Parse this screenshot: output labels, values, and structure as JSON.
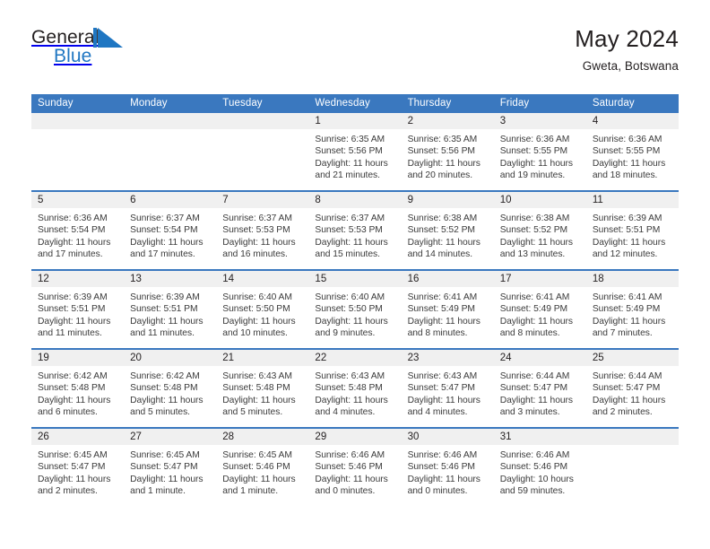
{
  "brand": {
    "name_part1": "General",
    "name_part2": "Blue",
    "triangle_color": "#1f76c2",
    "text_color": "#231f20"
  },
  "header": {
    "title": "May 2024",
    "subtitle": "Gweta, Botswana"
  },
  "theme": {
    "header_bar_color": "#3a78bf",
    "daynum_band_color": "#f0f0f0",
    "separator_color": "#3a78bf",
    "body_text_color": "#3b3b3b"
  },
  "weekday_headers": [
    "Sunday",
    "Monday",
    "Tuesday",
    "Wednesday",
    "Thursday",
    "Friday",
    "Saturday"
  ],
  "weeks": [
    [
      {
        "day": "",
        "lines": []
      },
      {
        "day": "",
        "lines": []
      },
      {
        "day": "",
        "lines": []
      },
      {
        "day": "1",
        "lines": [
          "Sunrise: 6:35 AM",
          "Sunset: 5:56 PM",
          "Daylight: 11 hours",
          "and 21 minutes."
        ]
      },
      {
        "day": "2",
        "lines": [
          "Sunrise: 6:35 AM",
          "Sunset: 5:56 PM",
          "Daylight: 11 hours",
          "and 20 minutes."
        ]
      },
      {
        "day": "3",
        "lines": [
          "Sunrise: 6:36 AM",
          "Sunset: 5:55 PM",
          "Daylight: 11 hours",
          "and 19 minutes."
        ]
      },
      {
        "day": "4",
        "lines": [
          "Sunrise: 6:36 AM",
          "Sunset: 5:55 PM",
          "Daylight: 11 hours",
          "and 18 minutes."
        ]
      }
    ],
    [
      {
        "day": "5",
        "lines": [
          "Sunrise: 6:36 AM",
          "Sunset: 5:54 PM",
          "Daylight: 11 hours",
          "and 17 minutes."
        ]
      },
      {
        "day": "6",
        "lines": [
          "Sunrise: 6:37 AM",
          "Sunset: 5:54 PM",
          "Daylight: 11 hours",
          "and 17 minutes."
        ]
      },
      {
        "day": "7",
        "lines": [
          "Sunrise: 6:37 AM",
          "Sunset: 5:53 PM",
          "Daylight: 11 hours",
          "and 16 minutes."
        ]
      },
      {
        "day": "8",
        "lines": [
          "Sunrise: 6:37 AM",
          "Sunset: 5:53 PM",
          "Daylight: 11 hours",
          "and 15 minutes."
        ]
      },
      {
        "day": "9",
        "lines": [
          "Sunrise: 6:38 AM",
          "Sunset: 5:52 PM",
          "Daylight: 11 hours",
          "and 14 minutes."
        ]
      },
      {
        "day": "10",
        "lines": [
          "Sunrise: 6:38 AM",
          "Sunset: 5:52 PM",
          "Daylight: 11 hours",
          "and 13 minutes."
        ]
      },
      {
        "day": "11",
        "lines": [
          "Sunrise: 6:39 AM",
          "Sunset: 5:51 PM",
          "Daylight: 11 hours",
          "and 12 minutes."
        ]
      }
    ],
    [
      {
        "day": "12",
        "lines": [
          "Sunrise: 6:39 AM",
          "Sunset: 5:51 PM",
          "Daylight: 11 hours",
          "and 11 minutes."
        ]
      },
      {
        "day": "13",
        "lines": [
          "Sunrise: 6:39 AM",
          "Sunset: 5:51 PM",
          "Daylight: 11 hours",
          "and 11 minutes."
        ]
      },
      {
        "day": "14",
        "lines": [
          "Sunrise: 6:40 AM",
          "Sunset: 5:50 PM",
          "Daylight: 11 hours",
          "and 10 minutes."
        ]
      },
      {
        "day": "15",
        "lines": [
          "Sunrise: 6:40 AM",
          "Sunset: 5:50 PM",
          "Daylight: 11 hours",
          "and 9 minutes."
        ]
      },
      {
        "day": "16",
        "lines": [
          "Sunrise: 6:41 AM",
          "Sunset: 5:49 PM",
          "Daylight: 11 hours",
          "and 8 minutes."
        ]
      },
      {
        "day": "17",
        "lines": [
          "Sunrise: 6:41 AM",
          "Sunset: 5:49 PM",
          "Daylight: 11 hours",
          "and 8 minutes."
        ]
      },
      {
        "day": "18",
        "lines": [
          "Sunrise: 6:41 AM",
          "Sunset: 5:49 PM",
          "Daylight: 11 hours",
          "and 7 minutes."
        ]
      }
    ],
    [
      {
        "day": "19",
        "lines": [
          "Sunrise: 6:42 AM",
          "Sunset: 5:48 PM",
          "Daylight: 11 hours",
          "and 6 minutes."
        ]
      },
      {
        "day": "20",
        "lines": [
          "Sunrise: 6:42 AM",
          "Sunset: 5:48 PM",
          "Daylight: 11 hours",
          "and 5 minutes."
        ]
      },
      {
        "day": "21",
        "lines": [
          "Sunrise: 6:43 AM",
          "Sunset: 5:48 PM",
          "Daylight: 11 hours",
          "and 5 minutes."
        ]
      },
      {
        "day": "22",
        "lines": [
          "Sunrise: 6:43 AM",
          "Sunset: 5:48 PM",
          "Daylight: 11 hours",
          "and 4 minutes."
        ]
      },
      {
        "day": "23",
        "lines": [
          "Sunrise: 6:43 AM",
          "Sunset: 5:47 PM",
          "Daylight: 11 hours",
          "and 4 minutes."
        ]
      },
      {
        "day": "24",
        "lines": [
          "Sunrise: 6:44 AM",
          "Sunset: 5:47 PM",
          "Daylight: 11 hours",
          "and 3 minutes."
        ]
      },
      {
        "day": "25",
        "lines": [
          "Sunrise: 6:44 AM",
          "Sunset: 5:47 PM",
          "Daylight: 11 hours",
          "and 2 minutes."
        ]
      }
    ],
    [
      {
        "day": "26",
        "lines": [
          "Sunrise: 6:45 AM",
          "Sunset: 5:47 PM",
          "Daylight: 11 hours",
          "and 2 minutes."
        ]
      },
      {
        "day": "27",
        "lines": [
          "Sunrise: 6:45 AM",
          "Sunset: 5:47 PM",
          "Daylight: 11 hours",
          "and 1 minute."
        ]
      },
      {
        "day": "28",
        "lines": [
          "Sunrise: 6:45 AM",
          "Sunset: 5:46 PM",
          "Daylight: 11 hours",
          "and 1 minute."
        ]
      },
      {
        "day": "29",
        "lines": [
          "Sunrise: 6:46 AM",
          "Sunset: 5:46 PM",
          "Daylight: 11 hours",
          "and 0 minutes."
        ]
      },
      {
        "day": "30",
        "lines": [
          "Sunrise: 6:46 AM",
          "Sunset: 5:46 PM",
          "Daylight: 11 hours",
          "and 0 minutes."
        ]
      },
      {
        "day": "31",
        "lines": [
          "Sunrise: 6:46 AM",
          "Sunset: 5:46 PM",
          "Daylight: 10 hours",
          "and 59 minutes."
        ]
      },
      {
        "day": "",
        "lines": []
      }
    ]
  ]
}
